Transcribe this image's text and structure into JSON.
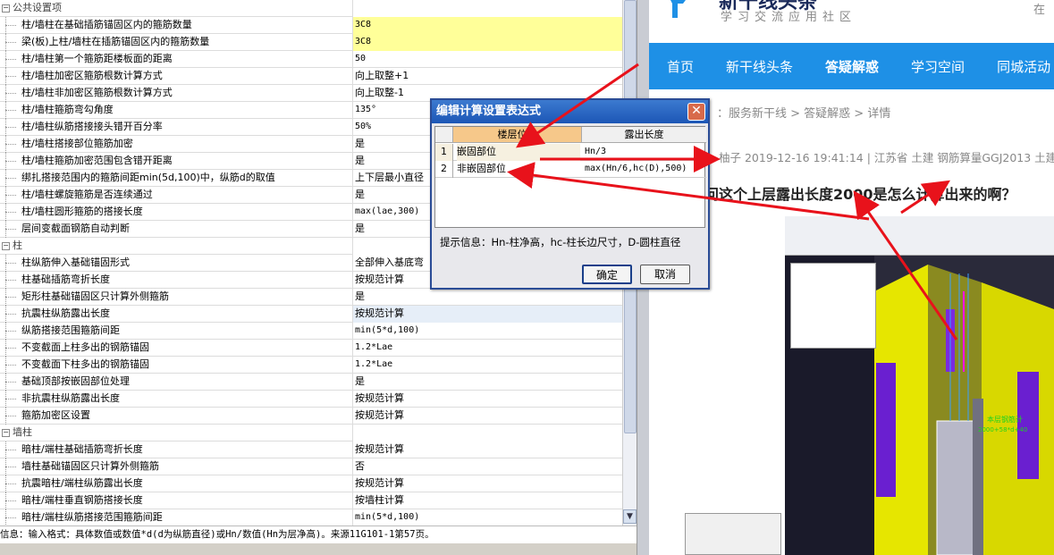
{
  "settings": {
    "groups": [
      {
        "label": "公共设置项",
        "rows": [
          {
            "name": "柱/墙柱在基础插筋锚固区内的箍筋数量",
            "value": "3C8",
            "highlight": "yellow"
          },
          {
            "name": "梁(板)上柱/墙柱在插筋锚固区内的箍筋数量",
            "value": "3C8",
            "highlight": "yellow"
          },
          {
            "name": "柱/墙柱第一个箍筋距楼板面的距离",
            "value": "50"
          },
          {
            "name": "柱/墙柱加密区箍筋根数计算方式",
            "value": "向上取整+1"
          },
          {
            "name": "柱/墙柱非加密区箍筋根数计算方式",
            "value": "向上取整-1"
          },
          {
            "name": "柱/墙柱箍筋弯勾角度",
            "value": "135°"
          },
          {
            "name": "柱/墙柱纵筋搭接接头错开百分率",
            "value": "50%"
          },
          {
            "name": "柱/墙柱搭接部位箍筋加密",
            "value": "是"
          },
          {
            "name": "柱/墙柱箍筋加密范围包含错开距离",
            "value": "是"
          },
          {
            "name": "绑扎搭接范围内的箍筋间距min(5d,100)中，纵筋d的取值",
            "value": "上下层最小直径"
          },
          {
            "name": "柱/墙柱螺旋箍筋是否连续通过",
            "value": "是"
          },
          {
            "name": "柱/墙柱圆形箍筋的搭接长度",
            "value": "max(lae,300)"
          },
          {
            "name": "层间变截面钢筋自动判断",
            "value": "是"
          }
        ]
      },
      {
        "label": "柱",
        "rows": [
          {
            "name": "柱纵筋伸入基础锚固形式",
            "value": "全部伸入基底弯"
          },
          {
            "name": "柱基础插筋弯折长度",
            "value": "按规范计算"
          },
          {
            "name": "矩形柱基础锚固区只计算外侧箍筋",
            "value": "是"
          },
          {
            "name": "抗震柱纵筋露出长度",
            "value": "按规范计算",
            "highlight": "selected"
          },
          {
            "name": "纵筋搭接范围箍筋间距",
            "value": "min(5*d,100)"
          },
          {
            "name": "不变截面上柱多出的钢筋锚固",
            "value": "1.2*Lae"
          },
          {
            "name": "不变截面下柱多出的钢筋锚固",
            "value": "1.2*Lae"
          },
          {
            "name": "基础顶部按嵌固部位处理",
            "value": "是"
          },
          {
            "name": "非抗震柱纵筋露出长度",
            "value": "按规范计算"
          },
          {
            "name": "箍筋加密区设置",
            "value": "按规范计算"
          }
        ]
      },
      {
        "label": "墙柱",
        "rows": [
          {
            "name": "暗柱/端柱基础插筋弯折长度",
            "value": "按规范计算"
          },
          {
            "name": "墙柱基础锚固区只计算外侧箍筋",
            "value": "否"
          },
          {
            "name": "抗震暗柱/端柱纵筋露出长度",
            "value": "按规范计算"
          },
          {
            "name": "暗柱/端柱垂直钢筋搭接长度",
            "value": "按墙柱计算"
          },
          {
            "name": "暗柱/端柱纵筋搭接范围箍筋间距",
            "value": "min(5*d,100)"
          }
        ]
      }
    ],
    "status": "信息：输入格式：具体数值或数值*d(d为纵筋直径)或Hn/数值(Hn为层净高)。来源11G101-1第57页。"
  },
  "dialog": {
    "title": "编辑计算设置表达式",
    "columns": [
      "楼层位置",
      "露出长度"
    ],
    "rows": [
      {
        "index": "1",
        "position": "嵌固部位",
        "length": "Hn/3"
      },
      {
        "index": "2",
        "position": "非嵌固部位",
        "length": "max(Hn/6,hc(D),500)"
      }
    ],
    "hint": "提示信息：Hn-柱净高，hc-柱长边尺寸，D-圆柱直径",
    "ok_label": "确定",
    "cancel_label": "取消"
  },
  "web": {
    "logo_title": "新干线头条",
    "logo_sub": "学习交流应用社区",
    "top_right": "在",
    "nav": [
      "首页",
      "新干线头条",
      "答疑解惑",
      "学习空间",
      "同城活动"
    ],
    "breadcrumb": "：服务新干线 > 答疑解惑 > 详情",
    "meta": "柚子   2019-12-16 19:41:14   |   江苏省  土建 钢筋算量GGJ2013 土建",
    "question": "问这个上层露出长度2000是怎么计算出来的啊？"
  },
  "accent": "#1e90e6"
}
